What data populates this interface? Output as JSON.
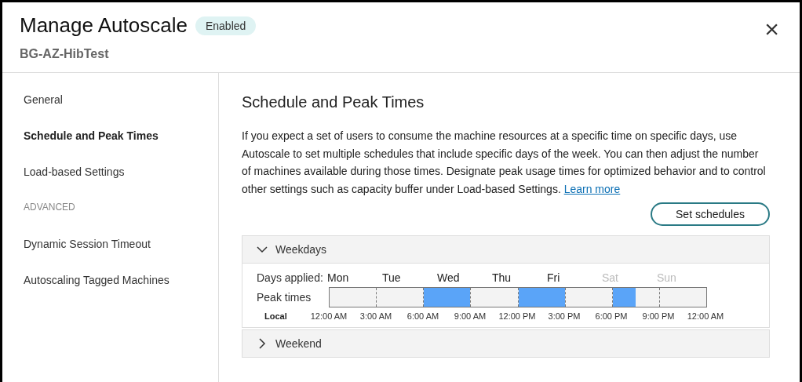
{
  "window": {
    "title": "Manage Autoscale",
    "badge": "Enabled",
    "subtitle": "BG-AZ-HibTest",
    "close": "×"
  },
  "sidebar": {
    "items": [
      {
        "kind": "link",
        "label": "General",
        "selected": false
      },
      {
        "kind": "link",
        "label": "Schedule and Peak Times",
        "selected": true
      },
      {
        "kind": "link",
        "label": "Load-based Settings",
        "selected": false
      },
      {
        "kind": "heading",
        "label": "ADVANCED"
      },
      {
        "kind": "link",
        "label": "Dynamic Session Timeout",
        "selected": false
      },
      {
        "kind": "link",
        "label": "Autoscaling Tagged Machines",
        "selected": false
      }
    ]
  },
  "content": {
    "heading": "Schedule and Peak Times",
    "description": "If you expect a set of users to consume the machine resources at a specific time on specific days, use Autoscale to set multiple schedules that include specific days of the week. You can then adjust the number of machines available during those times. Designate peak usage times for optimized behavior and to control other settings such as capacity buffer under Load-based Settings.",
    "learn_more": "Learn more",
    "set_schedules": "Set schedules",
    "schedules": [
      {
        "name": "Weekdays",
        "expanded": true,
        "days_label": "Days applied:",
        "peak_label": "Peak times",
        "zone_label": "Local",
        "days": [
          {
            "label": "Mon",
            "applied": true
          },
          {
            "label": "Tue",
            "applied": true
          },
          {
            "label": "Wed",
            "applied": true
          },
          {
            "label": "Thu",
            "applied": true
          },
          {
            "label": "Fri",
            "applied": true
          },
          {
            "label": "Sat",
            "applied": false
          },
          {
            "label": "Sun",
            "applied": false
          }
        ],
        "slots": [
          {
            "level": 0
          },
          {
            "level": 0
          },
          {
            "level": 1
          },
          {
            "level": 0
          },
          {
            "level": 1
          },
          {
            "level": 0
          },
          {
            "level": 0.5
          },
          {
            "level": 0
          }
        ],
        "times": [
          "12:00 AM",
          "3:00 AM",
          "6:00 AM",
          "9:00 AM",
          "12:00 PM",
          "3:00 PM",
          "6:00 PM",
          "9:00 PM",
          "12:00 AM"
        ]
      },
      {
        "name": "Weekend",
        "expanded": false
      }
    ]
  }
}
